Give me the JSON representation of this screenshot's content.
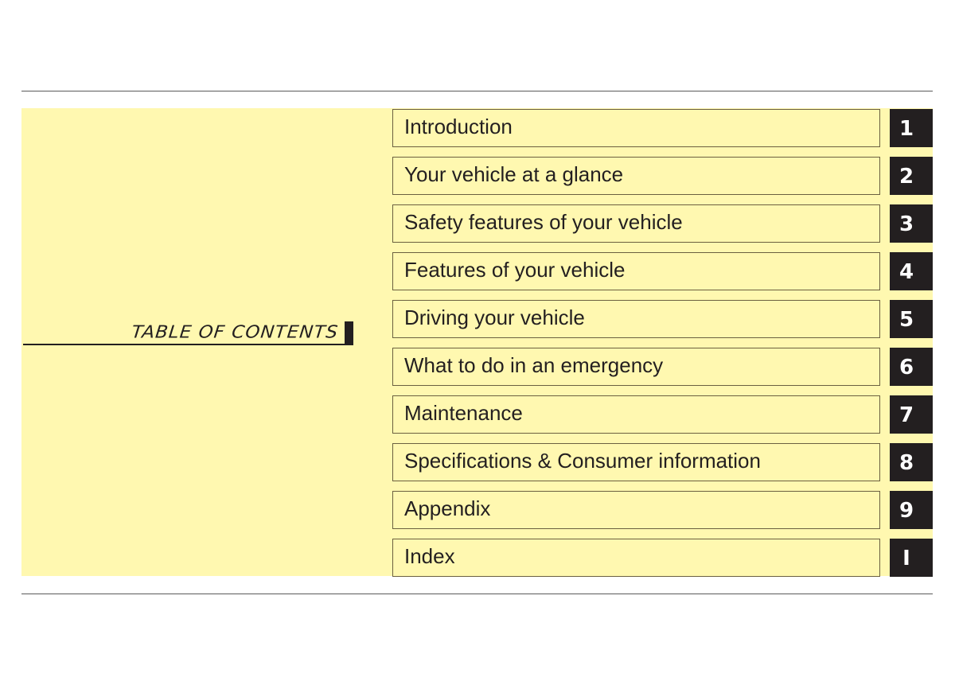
{
  "document": {
    "title": "TABLE OF CONTENTS",
    "colors": {
      "panel_background": "#fff8b0",
      "tab_background": "#231f20",
      "tab_text": "#ffffff",
      "text": "#231f20",
      "rule": "#5a5a5a"
    },
    "sections": [
      {
        "label": "Introduction",
        "tab": "1"
      },
      {
        "label": "Your vehicle at a glance",
        "tab": "2"
      },
      {
        "label": "Safety features of your vehicle",
        "tab": "3"
      },
      {
        "label": "Features of your vehicle",
        "tab": "4"
      },
      {
        "label": "Driving your vehicle",
        "tab": "5"
      },
      {
        "label": "What to do in an emergency",
        "tab": "6"
      },
      {
        "label": "Maintenance",
        "tab": "7"
      },
      {
        "label": "Specifications & Consumer information",
        "tab": "8"
      },
      {
        "label": "Appendix",
        "tab": "9"
      },
      {
        "label": "Index",
        "tab": "I"
      }
    ]
  }
}
